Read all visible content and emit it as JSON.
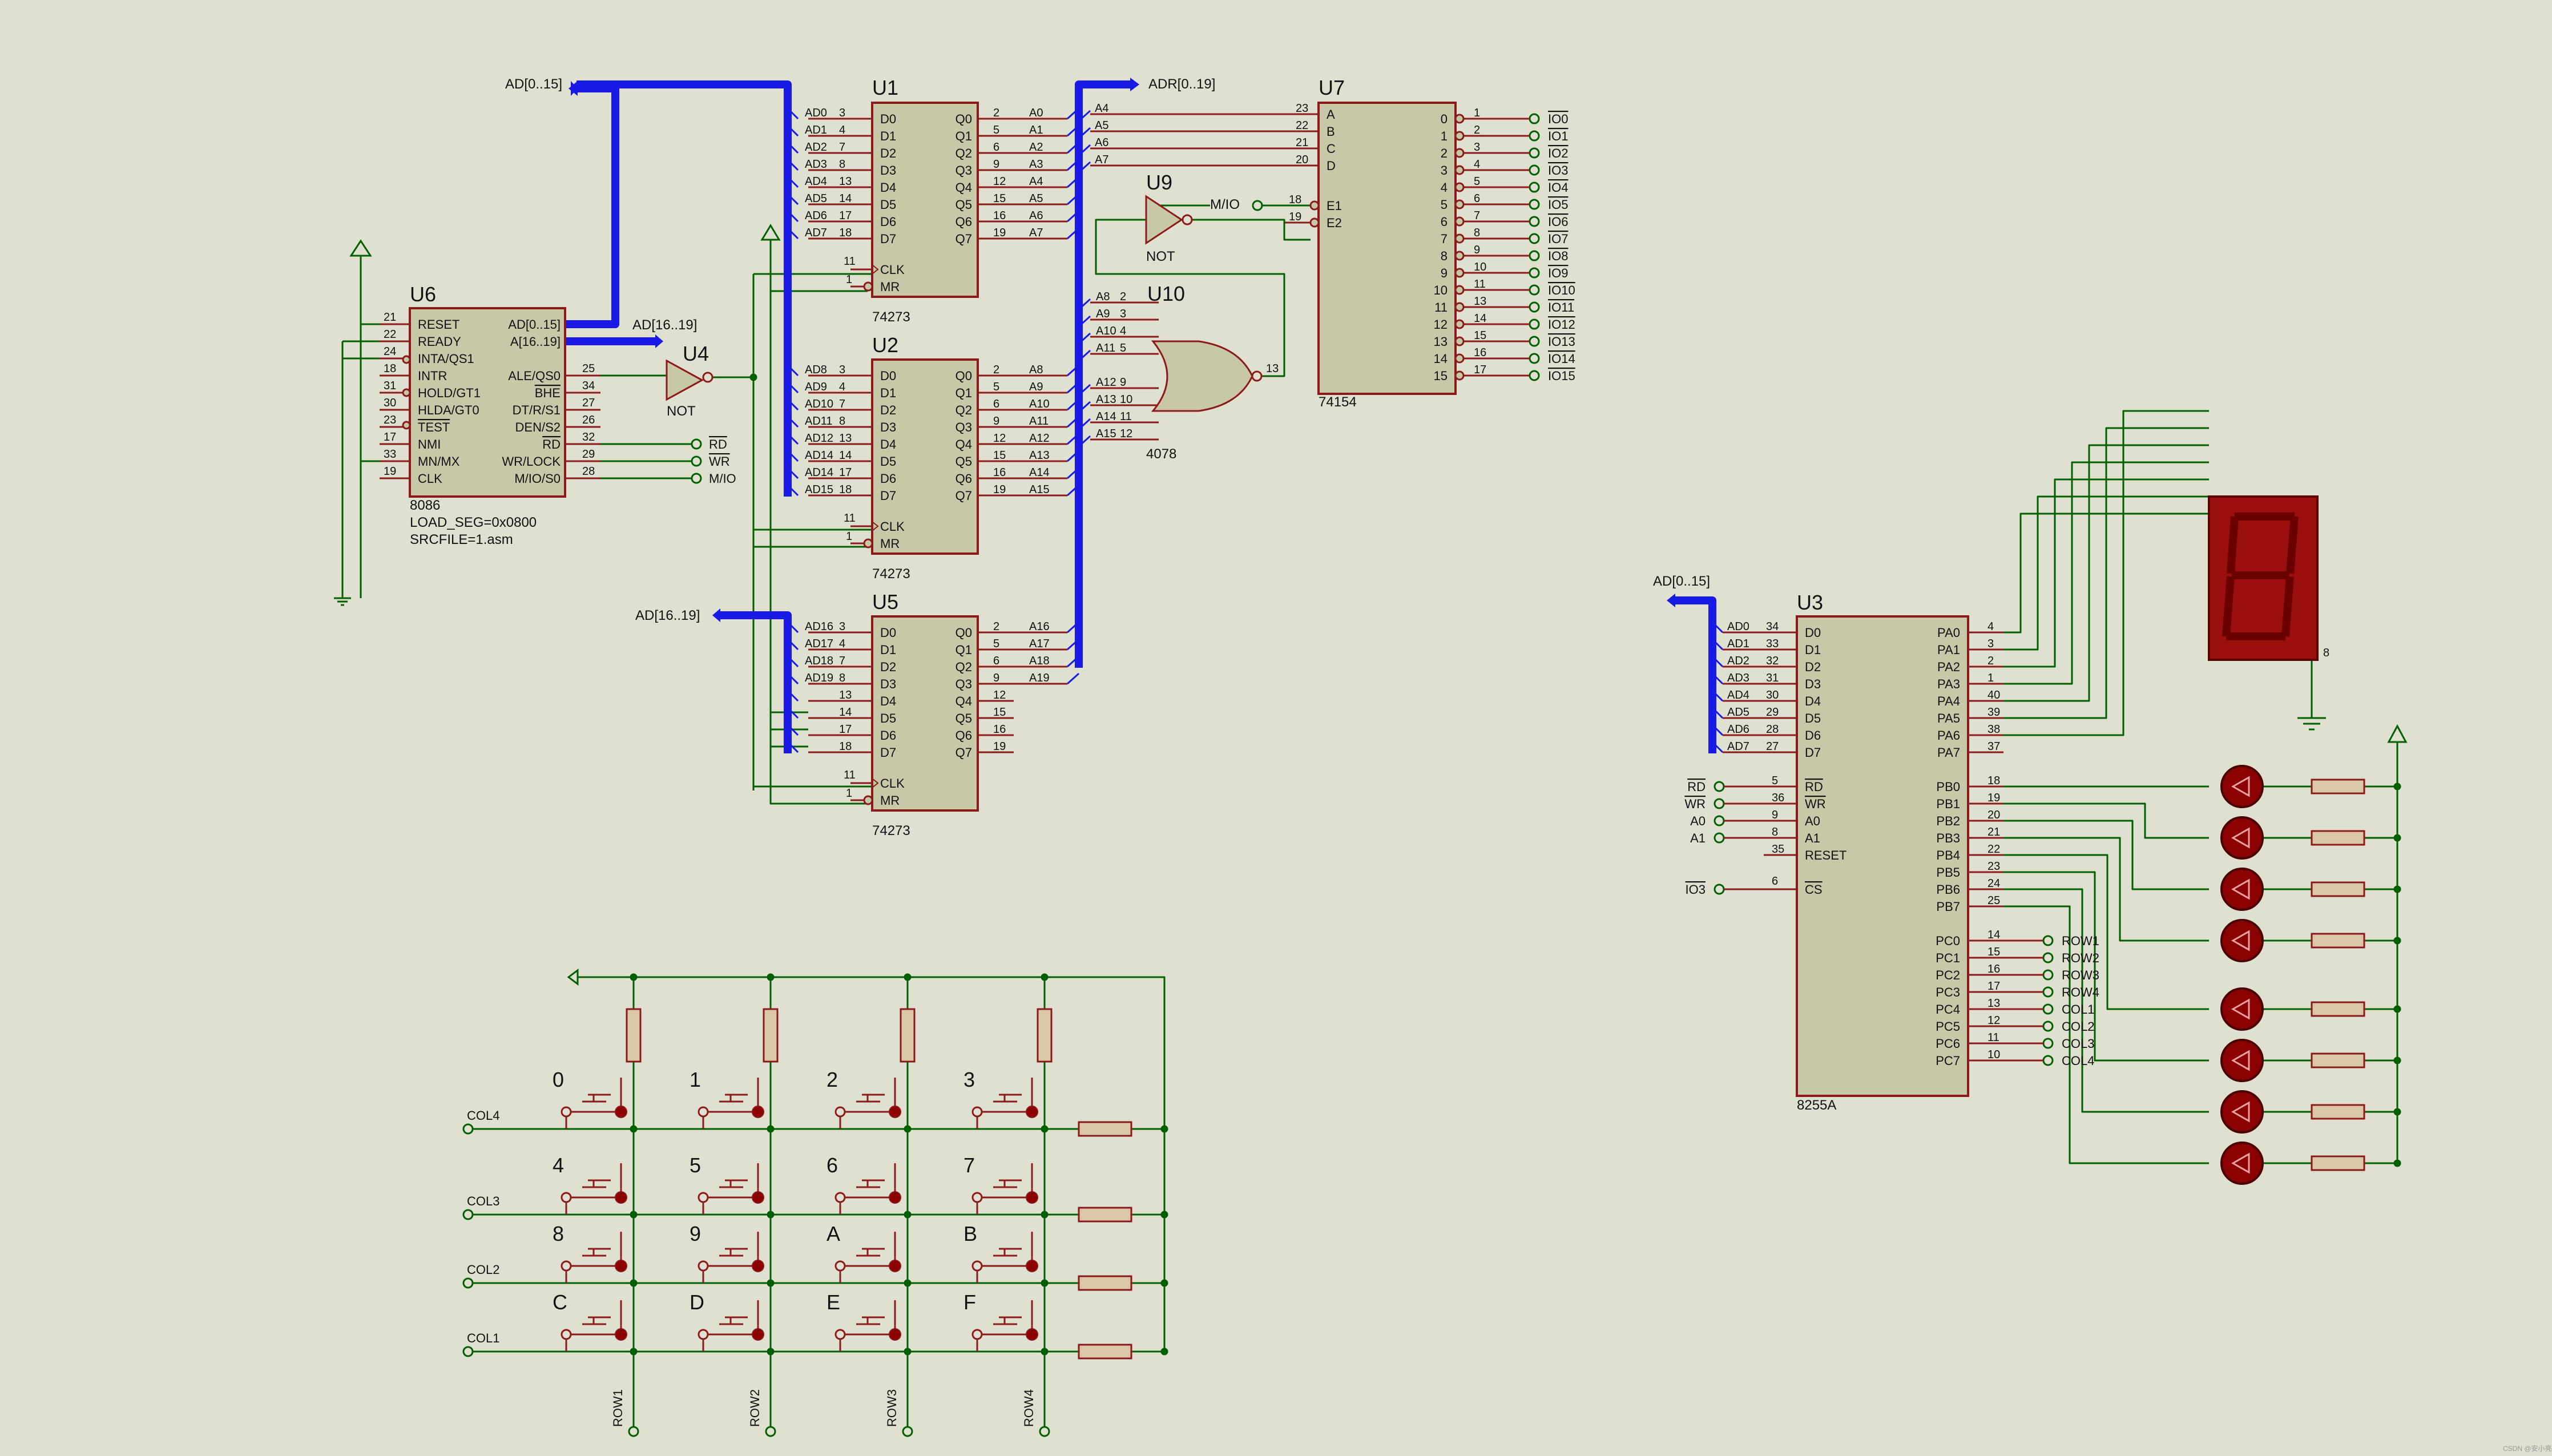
{
  "colors": {
    "background": "#e0e0d0",
    "chip_fill": "#c8c8a8",
    "chip_border": "#8b1a1a",
    "wire": "#006000",
    "bus": "#1a1ae6",
    "pin": "#8b1a1a",
    "led": "#8b0000",
    "seg_display": "#9b0f0f"
  },
  "u6": {
    "ref": "U6",
    "part": "8086",
    "load_seg": "LOAD_SEG=0x0800",
    "srcfile": "SRCFILE=1.asm",
    "left_pins": [
      {
        "num": "21",
        "name": "RESET"
      },
      {
        "num": "22",
        "name": "READY"
      },
      {
        "num": "24",
        "name": "INTA/QS1"
      },
      {
        "num": "18",
        "name": "INTR"
      },
      {
        "num": "31",
        "name": "HOLD/GT1"
      },
      {
        "num": "30",
        "name": "HLDA/GT0"
      },
      {
        "num": "23",
        "name": "TEST"
      },
      {
        "num": "17",
        "name": "NMI"
      },
      {
        "num": "33",
        "name": "MN/MX"
      },
      {
        "num": "19",
        "name": "CLK"
      }
    ],
    "right_pins": [
      {
        "num": "",
        "name": "AD[0..15]"
      },
      {
        "num": "",
        "name": "A[16..19]"
      },
      {
        "num": "",
        "name": ""
      },
      {
        "num": "25",
        "name": "ALE/QS0"
      },
      {
        "num": "34",
        "name": "BHE"
      },
      {
        "num": "27",
        "name": "DT/R/S1"
      },
      {
        "num": "26",
        "name": "DEN/S2"
      },
      {
        "num": "32",
        "name": "RD"
      },
      {
        "num": "29",
        "name": "WR/LOCK"
      },
      {
        "num": "28",
        "name": "M/IO/S0"
      }
    ],
    "bus_ad_label": "AD[0..15]",
    "bus_a_label": "AD[16..19]",
    "rd_term": "RD",
    "wr_term": "WR",
    "mio_term": "M/IO"
  },
  "u4": {
    "ref": "U4",
    "part": "NOT"
  },
  "u9": {
    "ref": "U9",
    "part": "NOT",
    "input_label": "M/IO"
  },
  "u1": {
    "ref": "U1",
    "part": "74273",
    "d_pins": [
      {
        "net": "AD0",
        "num": "3",
        "name": "D0"
      },
      {
        "net": "AD1",
        "num": "4",
        "name": "D1"
      },
      {
        "net": "AD2",
        "num": "7",
        "name": "D2"
      },
      {
        "net": "AD3",
        "num": "8",
        "name": "D3"
      },
      {
        "net": "AD4",
        "num": "13",
        "name": "D4"
      },
      {
        "net": "AD5",
        "num": "14",
        "name": "D5"
      },
      {
        "net": "AD6",
        "num": "17",
        "name": "D6"
      },
      {
        "net": "AD7",
        "num": "18",
        "name": "D7"
      }
    ],
    "q_pins": [
      {
        "num": "2",
        "name": "Q0",
        "net": "A0"
      },
      {
        "num": "5",
        "name": "Q1",
        "net": "A1"
      },
      {
        "num": "6",
        "name": "Q2",
        "net": "A2"
      },
      {
        "num": "9",
        "name": "Q3",
        "net": "A3"
      },
      {
        "num": "12",
        "name": "Q4",
        "net": "A4"
      },
      {
        "num": "15",
        "name": "Q5",
        "net": "A5"
      },
      {
        "num": "16",
        "name": "Q6",
        "net": "A6"
      },
      {
        "num": "19",
        "name": "Q7",
        "net": "A7"
      }
    ],
    "clk": {
      "num": "11",
      "name": "CLK"
    },
    "mr": {
      "num": "1",
      "name": "MR"
    }
  },
  "u2": {
    "ref": "U2",
    "part": "74273",
    "d_pins": [
      {
        "net": "AD8",
        "num": "3",
        "name": "D0"
      },
      {
        "net": "AD9",
        "num": "4",
        "name": "D1"
      },
      {
        "net": "AD10",
        "num": "7",
        "name": "D2"
      },
      {
        "net": "AD11",
        "num": "8",
        "name": "D3"
      },
      {
        "net": "AD12",
        "num": "13",
        "name": "D4"
      },
      {
        "net": "AD14",
        "num": "14",
        "name": "D5"
      },
      {
        "net": "AD14",
        "num": "17",
        "name": "D6"
      },
      {
        "net": "AD15",
        "num": "18",
        "name": "D7"
      }
    ],
    "q_pins": [
      {
        "num": "2",
        "name": "Q0",
        "net": "A8"
      },
      {
        "num": "5",
        "name": "Q1",
        "net": "A9"
      },
      {
        "num": "6",
        "name": "Q2",
        "net": "A10"
      },
      {
        "num": "9",
        "name": "Q3",
        "net": "A11"
      },
      {
        "num": "12",
        "name": "Q4",
        "net": "A12"
      },
      {
        "num": "15",
        "name": "Q5",
        "net": "A13"
      },
      {
        "num": "16",
        "name": "Q6",
        "net": "A14"
      },
      {
        "num": "19",
        "name": "Q7",
        "net": "A15"
      }
    ],
    "clk": {
      "num": "11",
      "name": "CLK"
    },
    "mr": {
      "num": "1",
      "name": "MR"
    }
  },
  "u5": {
    "ref": "U5",
    "part": "74273",
    "bus_label": "AD[16..19]",
    "d_pins": [
      {
        "net": "AD16",
        "num": "3",
        "name": "D0"
      },
      {
        "net": "AD17",
        "num": "4",
        "name": "D1"
      },
      {
        "net": "AD18",
        "num": "7",
        "name": "D2"
      },
      {
        "net": "AD19",
        "num": "8",
        "name": "D3"
      },
      {
        "net": "",
        "num": "13",
        "name": "D4"
      },
      {
        "net": "",
        "num": "14",
        "name": "D5"
      },
      {
        "net": "",
        "num": "17",
        "name": "D6"
      },
      {
        "net": "",
        "num": "18",
        "name": "D7"
      }
    ],
    "q_pins": [
      {
        "num": "2",
        "name": "Q0",
        "net": "A16"
      },
      {
        "num": "5",
        "name": "Q1",
        "net": "A17"
      },
      {
        "num": "6",
        "name": "Q2",
        "net": "A18"
      },
      {
        "num": "9",
        "name": "Q3",
        "net": "A19"
      },
      {
        "num": "12",
        "name": "Q4",
        "net": ""
      },
      {
        "num": "15",
        "name": "Q5",
        "net": ""
      },
      {
        "num": "16",
        "name": "Q6",
        "net": ""
      },
      {
        "num": "19",
        "name": "Q7",
        "net": ""
      }
    ],
    "clk": {
      "num": "11",
      "name": "CLK"
    },
    "mr": {
      "num": "1",
      "name": "MR"
    }
  },
  "adr_bus_label": "ADR[0..19]",
  "u7": {
    "ref": "U7",
    "part": "74154",
    "in_nets": [
      "A4",
      "A5",
      "A6",
      "A7"
    ],
    "in_pins": [
      {
        "num": "23",
        "name": "A"
      },
      {
        "num": "22",
        "name": "B"
      },
      {
        "num": "21",
        "name": "C"
      },
      {
        "num": "20",
        "name": "D"
      }
    ],
    "en_pins": [
      {
        "num": "18",
        "name": "E1"
      },
      {
        "num": "19",
        "name": "E2"
      }
    ],
    "out_pins": [
      {
        "idx": "0",
        "num": "1",
        "net": "IO0"
      },
      {
        "idx": "1",
        "num": "2",
        "net": "IO1"
      },
      {
        "idx": "2",
        "num": "3",
        "net": "IO2"
      },
      {
        "idx": "3",
        "num": "4",
        "net": "IO3"
      },
      {
        "idx": "4",
        "num": "5",
        "net": "IO4"
      },
      {
        "idx": "5",
        "num": "6",
        "net": "IO5"
      },
      {
        "idx": "6",
        "num": "7",
        "net": "IO6"
      },
      {
        "idx": "7",
        "num": "8",
        "net": "IO7"
      },
      {
        "idx": "8",
        "num": "9",
        "net": "IO8"
      },
      {
        "idx": "9",
        "num": "10",
        "net": "IO9"
      },
      {
        "idx": "10",
        "num": "11",
        "net": "IO10"
      },
      {
        "idx": "11",
        "num": "13",
        "net": "IO11"
      },
      {
        "idx": "12",
        "num": "14",
        "net": "IO12"
      },
      {
        "idx": "13",
        "num": "15",
        "net": "IO13"
      },
      {
        "idx": "14",
        "num": "16",
        "net": "IO14"
      },
      {
        "idx": "15",
        "num": "17",
        "net": "IO15"
      }
    ]
  },
  "u10": {
    "ref": "U10",
    "part": "4078",
    "out_num": "13",
    "inputs": [
      {
        "net": "A8",
        "num": "2"
      },
      {
        "net": "A9",
        "num": "3"
      },
      {
        "net": "A10",
        "num": "4"
      },
      {
        "net": "A11",
        "num": "5"
      },
      {
        "net": "A12",
        "num": "9"
      },
      {
        "net": "A13",
        "num": "10"
      },
      {
        "net": "A14",
        "num": "11"
      },
      {
        "net": "A15",
        "num": "12"
      }
    ]
  },
  "u3": {
    "ref": "U3",
    "part": "8255A",
    "bus_label": "AD[0..15]",
    "d_pins": [
      {
        "net": "AD0",
        "num": "34",
        "name": "D0"
      },
      {
        "net": "AD1",
        "num": "33",
        "name": "D1"
      },
      {
        "net": "AD2",
        "num": "32",
        "name": "D2"
      },
      {
        "net": "AD3",
        "num": "31",
        "name": "D3"
      },
      {
        "net": "AD4",
        "num": "30",
        "name": "D4"
      },
      {
        "net": "AD5",
        "num": "29",
        "name": "D5"
      },
      {
        "net": "AD6",
        "num": "28",
        "name": "D6"
      },
      {
        "net": "AD7",
        "num": "27",
        "name": "D7"
      }
    ],
    "ctrl_pins": [
      {
        "term": "RD",
        "num": "5",
        "name": "RD"
      },
      {
        "term": "WR",
        "num": "36",
        "name": "WR"
      },
      {
        "term": "A0",
        "num": "9",
        "name": "A0"
      },
      {
        "term": "A1",
        "num": "8",
        "name": "A1"
      },
      {
        "term": "",
        "num": "35",
        "name": "RESET"
      }
    ],
    "cs": {
      "term": "IO3",
      "num": "6",
      "name": "CS"
    },
    "pa_pins": [
      {
        "name": "PA0",
        "num": "4"
      },
      {
        "name": "PA1",
        "num": "3"
      },
      {
        "name": "PA2",
        "num": "2"
      },
      {
        "name": "PA3",
        "num": "1"
      },
      {
        "name": "PA4",
        "num": "40"
      },
      {
        "name": "PA5",
        "num": "39"
      },
      {
        "name": "PA6",
        "num": "38"
      },
      {
        "name": "PA7",
        "num": "37"
      }
    ],
    "pb_pins": [
      {
        "name": "PB0",
        "num": "18"
      },
      {
        "name": "PB1",
        "num": "19"
      },
      {
        "name": "PB2",
        "num": "20"
      },
      {
        "name": "PB3",
        "num": "21"
      },
      {
        "name": "PB4",
        "num": "22"
      },
      {
        "name": "PB5",
        "num": "23"
      },
      {
        "name": "PB6",
        "num": "24"
      },
      {
        "name": "PB7",
        "num": "25"
      }
    ],
    "pc_pins": [
      {
        "name": "PC0",
        "num": "14",
        "net": "ROW1"
      },
      {
        "name": "PC1",
        "num": "15",
        "net": "ROW2"
      },
      {
        "name": "PC2",
        "num": "16",
        "net": "ROW3"
      },
      {
        "name": "PC3",
        "num": "17",
        "net": "ROW4"
      },
      {
        "name": "PC4",
        "num": "13",
        "net": "COL1"
      },
      {
        "name": "PC5",
        "num": "12",
        "net": "COL2"
      },
      {
        "name": "PC6",
        "num": "11",
        "net": "COL3"
      },
      {
        "name": "PC7",
        "num": "10",
        "net": "COL4"
      }
    ]
  },
  "keypad": {
    "rows": [
      {
        "col_label": "COL4",
        "keys": [
          "0",
          "1",
          "2",
          "3"
        ]
      },
      {
        "col_label": "COL3",
        "keys": [
          "4",
          "5",
          "6",
          "7"
        ]
      },
      {
        "col_label": "COL2",
        "keys": [
          "8",
          "9",
          "A",
          "B"
        ]
      },
      {
        "col_label": "COL1",
        "keys": [
          "C",
          "D",
          "E",
          "F"
        ]
      }
    ],
    "row_labels": [
      "ROW1",
      "ROW2",
      "ROW3",
      "ROW4"
    ]
  },
  "seven_segment": {
    "digit": "8"
  },
  "watermark": "CSDN @安小亮"
}
